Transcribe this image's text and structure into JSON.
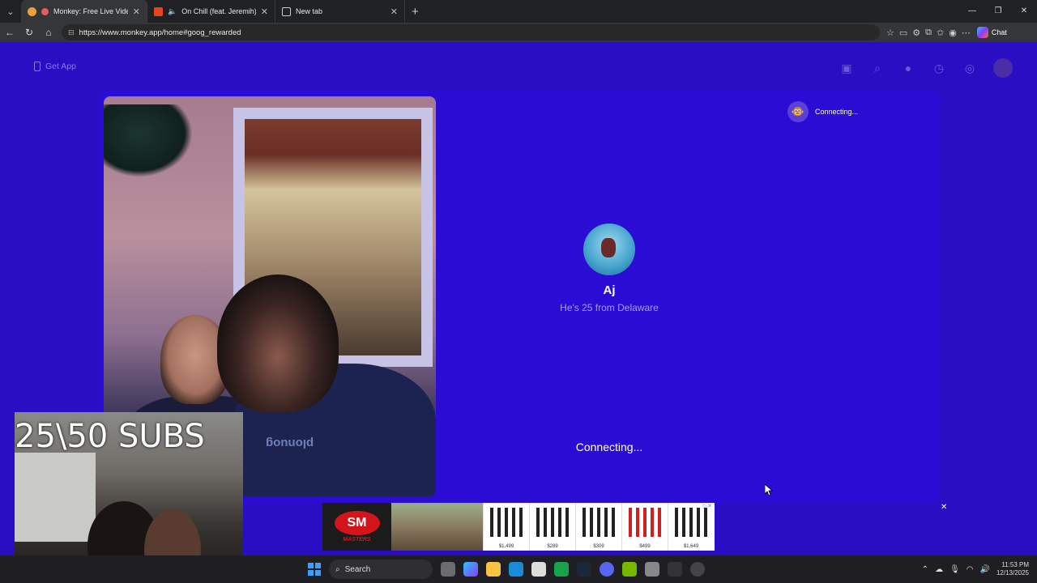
{
  "browser": {
    "tabs": [
      {
        "title": "Monkey: Free Live Video Chat",
        "active": true
      },
      {
        "title": "On Chill (feat. Jeremih) by W",
        "active": false
      },
      {
        "title": "New tab",
        "active": false
      }
    ],
    "url": "https://www.monkey.app/home#goog_rewarded",
    "chat_label": "Chat"
  },
  "page": {
    "get_app_label": "Get App",
    "remote_status": "Connecting...",
    "profile": {
      "name": "Aj",
      "subtitle": "He's 25 from Delaware"
    },
    "connecting_label": "Connecting...",
    "shirt_text": "plonuog"
  },
  "overlay": {
    "subs_text": "25\\50 SUBS"
  },
  "ad": {
    "logo_text": "SM",
    "logo_sub": "MASTERS",
    "prices": [
      "$1,499",
      "$289",
      "$309",
      "$499",
      "$1,649"
    ]
  },
  "taskbar": {
    "search_label": "Search",
    "time": "11:53 PM",
    "date": "12/13/2025"
  }
}
